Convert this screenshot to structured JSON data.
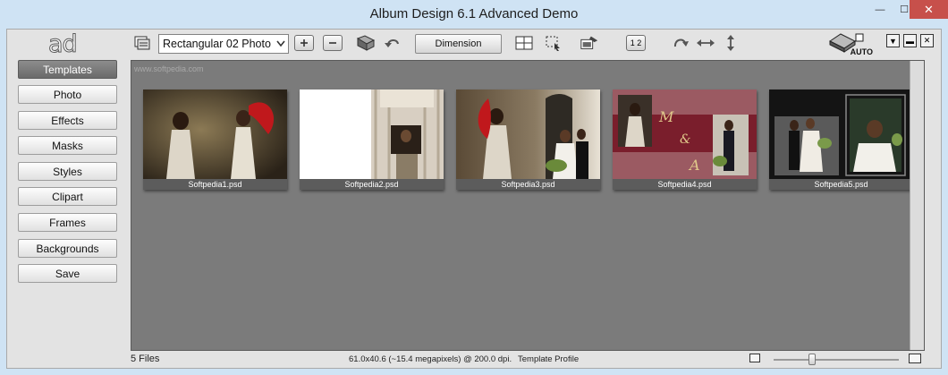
{
  "window": {
    "title": "Album Design 6.1 Advanced Demo",
    "minimize_glyph": "—",
    "maximize_glyph": "☐",
    "close_glyph": "✕"
  },
  "toolbar": {
    "logo_text": "ad",
    "template_select": "Rectangular 02 Photo",
    "dimension_label": "Dimension",
    "page_numbers": "1 2",
    "auto_label": "AUTO",
    "dropdown_glyph": "▼",
    "min_glyph": "▬",
    "close_glyph": "✕"
  },
  "sidebar": {
    "items": [
      {
        "label": "Templates",
        "active": true
      },
      {
        "label": "Photo",
        "active": false
      },
      {
        "label": "Effects",
        "active": false
      },
      {
        "label": "Masks",
        "active": false
      },
      {
        "label": "Styles",
        "active": false
      },
      {
        "label": "Clipart",
        "active": false
      },
      {
        "label": "Frames",
        "active": false
      },
      {
        "label": "Backgrounds",
        "active": false
      },
      {
        "label": "Save",
        "active": false
      }
    ]
  },
  "content": {
    "watermark": "www.softpedia.com",
    "thumbnails": [
      {
        "name": "Softpedia1.psd"
      },
      {
        "name": "Softpedia2.psd"
      },
      {
        "name": "Softpedia3.psd"
      },
      {
        "name": "Softpedia4.psd"
      },
      {
        "name": "Softpedia5.psd"
      }
    ]
  },
  "status": {
    "files": "5 Files",
    "info": "61.0x40.6 (~15.4 megapixels) @ 200.0 dpi.",
    "profile": "Template Profile"
  },
  "colors": {
    "accent_red": "#c7504b",
    "content_bg": "#7b7b7b",
    "title_bg": "#cfe3f4",
    "maroon": "#7a1e2c"
  }
}
